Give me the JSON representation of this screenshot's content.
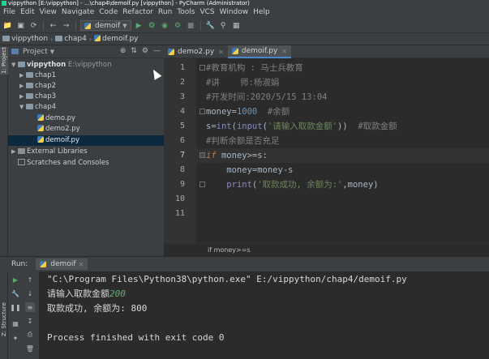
{
  "window": {
    "title": "vippython [E:\\vippython] - ...\\chap4\\demoif.py [vippython] - PyCharm (Administrator)"
  },
  "menu": [
    "File",
    "Edit",
    "View",
    "Navigate",
    "Code",
    "Refactor",
    "Run",
    "Tools",
    "VCS",
    "Window",
    "Help"
  ],
  "toolbar": {
    "run_config": "demoif"
  },
  "breadcrumb": [
    "vippython",
    "chap4",
    "demoif.py"
  ],
  "sidebar_tab": "1: Project",
  "project_panel": {
    "title": "Project",
    "tree": [
      {
        "label": "vippython",
        "extra": "E:\\vippython",
        "depth": 0,
        "expanded": true,
        "type": "folder"
      },
      {
        "label": "chap1",
        "depth": 1,
        "expanded": false,
        "type": "folder"
      },
      {
        "label": "chap2",
        "depth": 1,
        "expanded": false,
        "type": "folder"
      },
      {
        "label": "chap3",
        "depth": 1,
        "expanded": false,
        "type": "folder"
      },
      {
        "label": "chap4",
        "depth": 1,
        "expanded": true,
        "type": "folder"
      },
      {
        "label": "demo.py",
        "depth": 2,
        "type": "py"
      },
      {
        "label": "demo2.py",
        "depth": 2,
        "type": "py"
      },
      {
        "label": "demoif.py",
        "depth": 2,
        "type": "py",
        "selected": true
      },
      {
        "label": "External Libraries",
        "depth": 0,
        "expanded": false,
        "type": "lib"
      },
      {
        "label": "Scratches and Consoles",
        "depth": 0,
        "type": "scratch"
      }
    ]
  },
  "editor": {
    "tabs": [
      {
        "label": "demo2.py",
        "active": false
      },
      {
        "label": "demoif.py",
        "active": true
      }
    ],
    "line_numbers": [
      "1",
      "2",
      "3",
      "4",
      "5",
      "6",
      "7",
      "8",
      "9",
      "10",
      "11"
    ],
    "current_line": 7,
    "code": {
      "l1": "#教育机构 : 马士兵教育",
      "l2": "#讲    师:杨淑娟",
      "l3": "#开发时间:2020/5/15 13:04",
      "l4_var": "money=",
      "l4_num": "1000",
      "l4_cm": "#余额",
      "l5_a": "s=",
      "l5_int": "int",
      "l5_b": "(",
      "l5_input": "input",
      "l5_c": "(",
      "l5_str": "'请输入取款金额'",
      "l5_d": "))",
      "l5_cm": "#取款金额",
      "l6": "#判断余额是否充足",
      "l7_kw": "if",
      "l7_rest": " money>=s:",
      "l8": "    money=money-s",
      "l9_print": "print",
      "l9_a": "(",
      "l9_str": "'取款成功, 余额为:'",
      "l9_b": ",money)"
    },
    "crumb": "if money>=s"
  },
  "run_panel": {
    "label": "Run:",
    "tab": "demoif",
    "output": {
      "cmd": "\"C:\\Program Files\\Python38\\python.exe\" E:/vippython/chap4/demoif.py",
      "prompt": "请输入取款金额",
      "input": "200",
      "result": "取款成功, 余额为: 800",
      "exit": "Process finished with exit code 0"
    }
  },
  "structure_tab": "Z: Structure"
}
